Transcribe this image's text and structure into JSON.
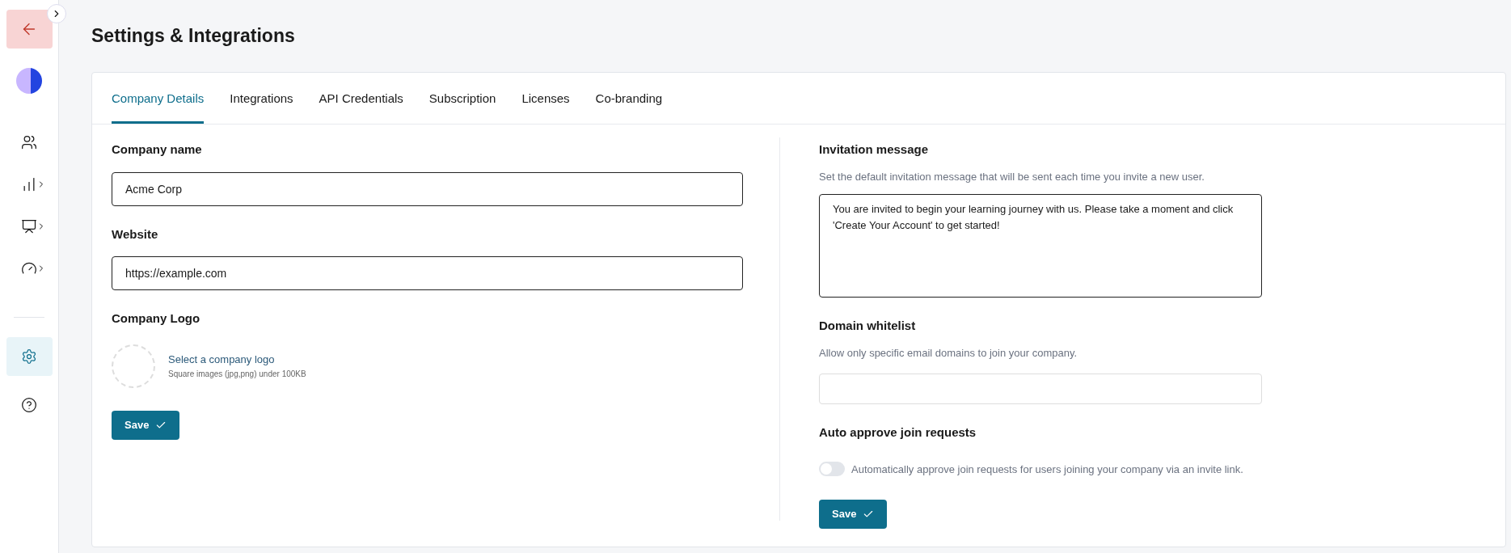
{
  "sidebar": {
    "items": [
      {
        "kind": "people",
        "selected": false,
        "expandable": false
      },
      {
        "kind": "chart",
        "selected": false,
        "expandable": true
      },
      {
        "kind": "board",
        "selected": false,
        "expandable": true
      },
      {
        "kind": "gauge",
        "selected": false,
        "expandable": true
      },
      {
        "kind": "settings",
        "selected": true,
        "expandable": false
      },
      {
        "kind": "help",
        "selected": false,
        "expandable": false
      }
    ]
  },
  "page_title": "Settings & Integrations",
  "tabs": [
    {
      "label": "Company Details",
      "selected": true
    },
    {
      "label": "Integrations",
      "selected": false
    },
    {
      "label": "API Credentials",
      "selected": false
    },
    {
      "label": "Subscription",
      "selected": false
    },
    {
      "label": "Licenses",
      "selected": false
    },
    {
      "label": "Co-branding",
      "selected": false
    }
  ],
  "company_details": {
    "company_name": {
      "label": "Company name",
      "value": "Acme Corp"
    },
    "website": {
      "label": "Website",
      "value": "https://example.com"
    },
    "logo": {
      "label": "Company Logo",
      "link": "Select a company logo",
      "hint": "Square images (jpg,png) under 100KB"
    },
    "save": "Save"
  },
  "invitation": {
    "label": "Invitation message",
    "description": "Set the default invitation message that will be sent each time you invite a new user.",
    "value": "You are invited to begin your learning journey with us. Please take a moment and click 'Create Your Account' to get started!"
  },
  "domain_whitelist": {
    "label": "Domain whitelist",
    "description": "Allow only specific email domains to join your company."
  },
  "auto_approve": {
    "label": "Auto approve join requests",
    "toggle_label": "Automatically approve join requests for users joining your company via an invite link.",
    "on": false
  },
  "right_save": "Save"
}
